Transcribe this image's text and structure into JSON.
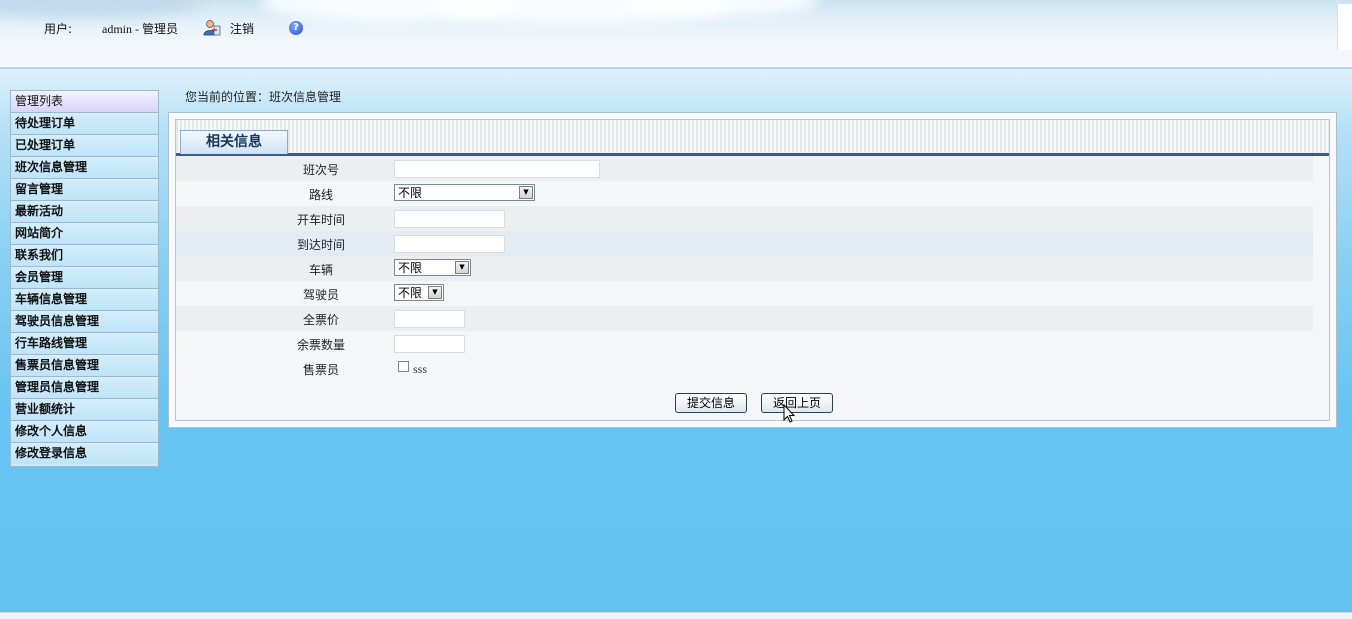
{
  "header": {
    "user_label": "用户:",
    "user_name": "admin - 管理员",
    "logout_label": "注销",
    "help_icon": "question-circle-icon",
    "logout_icon": "user-logout-icon"
  },
  "sidebar": {
    "title": "管理列表",
    "items": [
      {
        "label": "待处理订单"
      },
      {
        "label": "已处理订单"
      },
      {
        "label": "班次信息管理"
      },
      {
        "label": "留言管理"
      },
      {
        "label": "最新活动"
      },
      {
        "label": "网站简介"
      },
      {
        "label": "联系我们"
      },
      {
        "label": "会员管理"
      },
      {
        "label": "车辆信息管理"
      },
      {
        "label": "驾驶员信息管理"
      },
      {
        "label": "行车路线管理"
      },
      {
        "label": "售票员信息管理"
      },
      {
        "label": "管理员信息管理"
      },
      {
        "label": "营业额统计"
      },
      {
        "label": "修改个人信息"
      },
      {
        "label": "修改登录信息"
      }
    ]
  },
  "breadcrumb": {
    "text": "您当前的位置：班次信息管理"
  },
  "panel": {
    "tab_label": "相关信息"
  },
  "form": {
    "shift_no_label": "班次号",
    "route_label": "路线",
    "route_value": "不限",
    "depart_time_label": "开车时间",
    "arrive_time_label": "到达时间",
    "vehicle_label": "车辆",
    "vehicle_value": "不限",
    "driver_label": "驾驶员",
    "driver_value": "不限",
    "full_price_label": "全票价",
    "remaining_label": "余票数量",
    "seller_label": "售票员",
    "seller_option": "sss",
    "submit_label": "提交信息",
    "back_label": "返回上页"
  },
  "colors": {
    "background": "#66c4f2",
    "sidebar": "#c9e9fa",
    "tab_border": "#2f5f9a"
  }
}
